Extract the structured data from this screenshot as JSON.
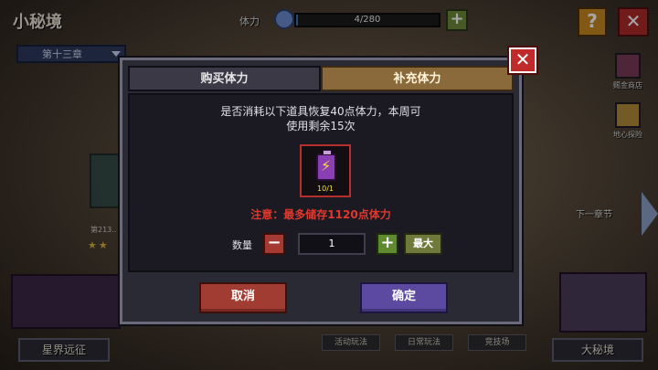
{
  "top": {
    "title": "小秘境",
    "chapter": "第十三章",
    "stamina_label": "体力",
    "stamina_value": "4/280",
    "stamina_fraction": 0.014,
    "help_label": "?",
    "close_label": "✕"
  },
  "side": {
    "shop": "赐金商店",
    "explore": "地心探险",
    "next_chapter": "下一章节"
  },
  "stage": {
    "label": "第213..",
    "stars": "★★"
  },
  "bottom": {
    "left": "星界远征",
    "right": "大秘境",
    "event": "活动玩法",
    "daily": "日常玩法",
    "arena": "竞技场"
  },
  "modal": {
    "tabs": [
      "购买体力",
      "补充体力"
    ],
    "active_tab": 1,
    "description_line1": "是否消耗以下道具恢复40点体力，本周可",
    "description_line2": "使用剩余15次",
    "item": {
      "name": "stamina-battery",
      "count": "10/1"
    },
    "warning": "注意：最多储存1120点体力",
    "quantity_label": "数量",
    "quantity_value": "1",
    "minus_label": "−",
    "plus_label": "+",
    "max_label": "最大",
    "cancel_label": "取消",
    "confirm_label": "确定",
    "close_label": "✕"
  },
  "colors": {
    "tab_active": "#8a6a3a",
    "warning": "#e0382e",
    "cancel": "#a13c32",
    "confirm": "#5b4aa0",
    "close": "#c02a2a"
  }
}
